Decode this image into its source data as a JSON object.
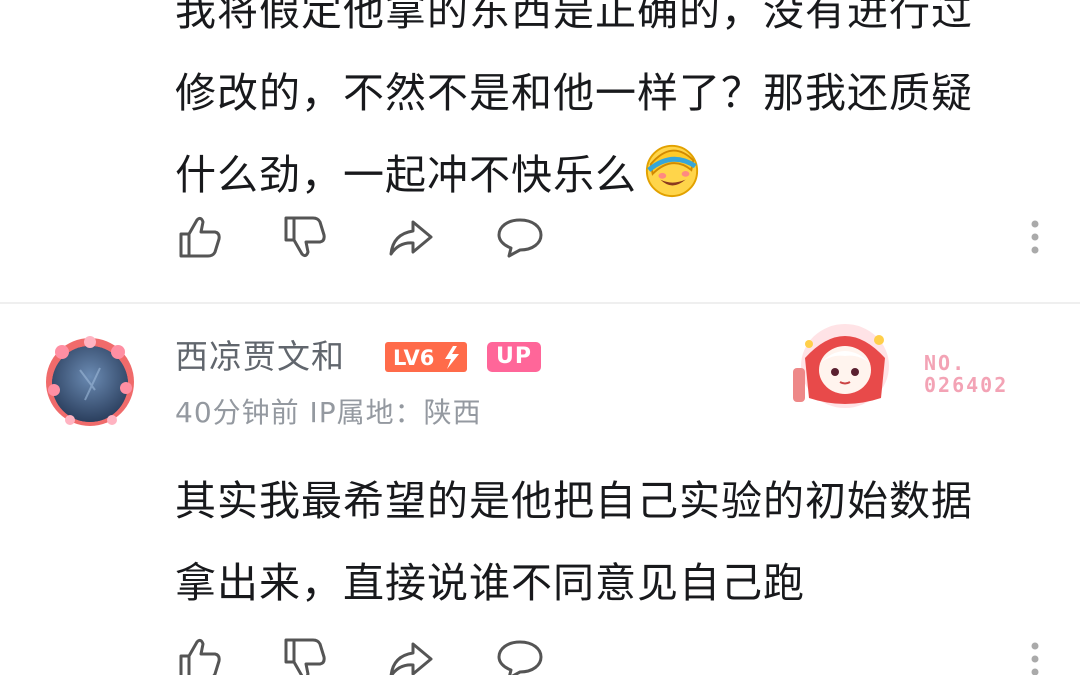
{
  "comments": [
    {
      "text_lines": [
        "我将假定他拿的东西是正确的，没有进行过",
        "修改的，不然不是和他一样了？那我还质疑",
        "什么劲，一起冲不快乐么"
      ],
      "emoji": "facepalm-laugh-emoji",
      "actions": [
        "like-icon",
        "dislike-icon",
        "share-icon",
        "reply-icon",
        "more-icon"
      ]
    },
    {
      "username": "西凉贾文和",
      "level": "LV6",
      "up_badge": "UP",
      "meta": "40分钟前 IP属地：陕西",
      "fan_number_label": "NO.",
      "fan_number": "026402",
      "text_lines": [
        "其实我最希望的是他把自己实验的初始数据",
        "拿出来，直接说谁不同意见自己跑"
      ],
      "actions": [
        "like-icon",
        "dislike-icon",
        "share-icon",
        "reply-icon",
        "more-icon"
      ]
    }
  ],
  "colors": {
    "text": "#18191c",
    "username": "#61666d",
    "meta": "#9499a0",
    "level": "#ff6b4a",
    "up": "#ff6699",
    "fan_no": "#f3a3b5"
  }
}
